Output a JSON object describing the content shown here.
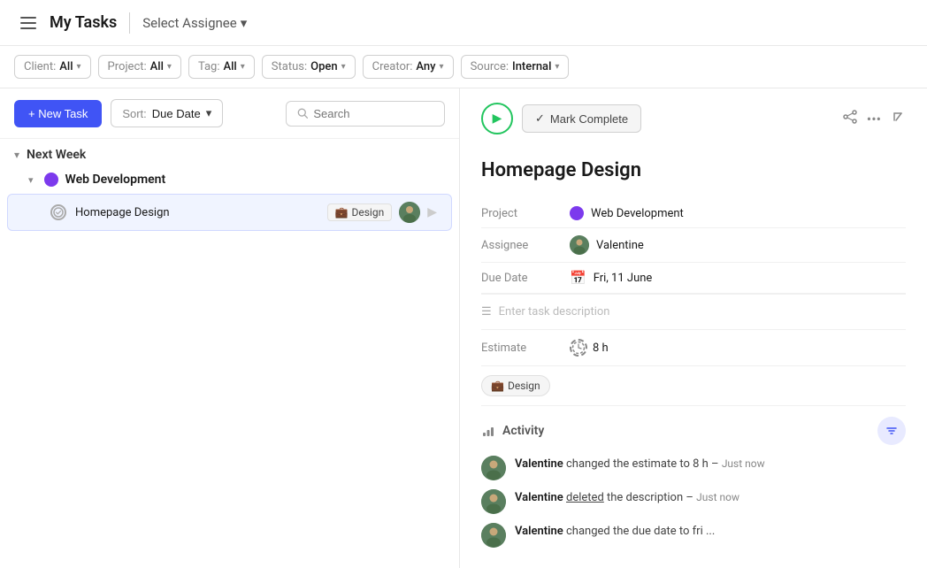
{
  "header": {
    "menu_icon": "☰",
    "title": "My Tasks",
    "divider": true,
    "assignee_selector": "Select Assignee",
    "assignee_chevron": "▾"
  },
  "filters": [
    {
      "label": "Client:",
      "value": "All"
    },
    {
      "label": "Project:",
      "value": "All"
    },
    {
      "label": "Tag:",
      "value": "All"
    },
    {
      "label": "Status:",
      "value": "Open"
    },
    {
      "label": "Creator:",
      "value": "Any"
    },
    {
      "label": "Source:",
      "value": "Internal"
    }
  ],
  "toolbar": {
    "new_task_label": "+ New Task",
    "sort_label": "Sort:",
    "sort_value": "Due Date",
    "search_placeholder": "Search"
  },
  "task_list": {
    "section_title": "Next Week",
    "project_name": "Web Development",
    "tasks": [
      {
        "name": "Homepage Design",
        "tag": "Design",
        "has_avatar": true
      }
    ]
  },
  "detail": {
    "title": "Homepage Design",
    "project_label": "Project",
    "project_value": "Web Development",
    "assignee_label": "Assignee",
    "assignee_value": "Valentine",
    "due_date_label": "Due Date",
    "due_date_value": "Fri, 11 June",
    "description_placeholder": "Enter task description",
    "estimate_label": "Estimate",
    "estimate_value": "8 h",
    "tag": "Design",
    "mark_complete_label": "Mark Complete",
    "activity_title": "Activity",
    "activity_items": [
      {
        "user": "Valentine",
        "action": "changed the estimate to 8 h",
        "time": "Just now"
      },
      {
        "user": "Valentine",
        "action": "deleted the description",
        "time": "Just now"
      },
      {
        "user": "Valentine",
        "action": "changed the due date to fri ...",
        "time": ""
      }
    ]
  }
}
